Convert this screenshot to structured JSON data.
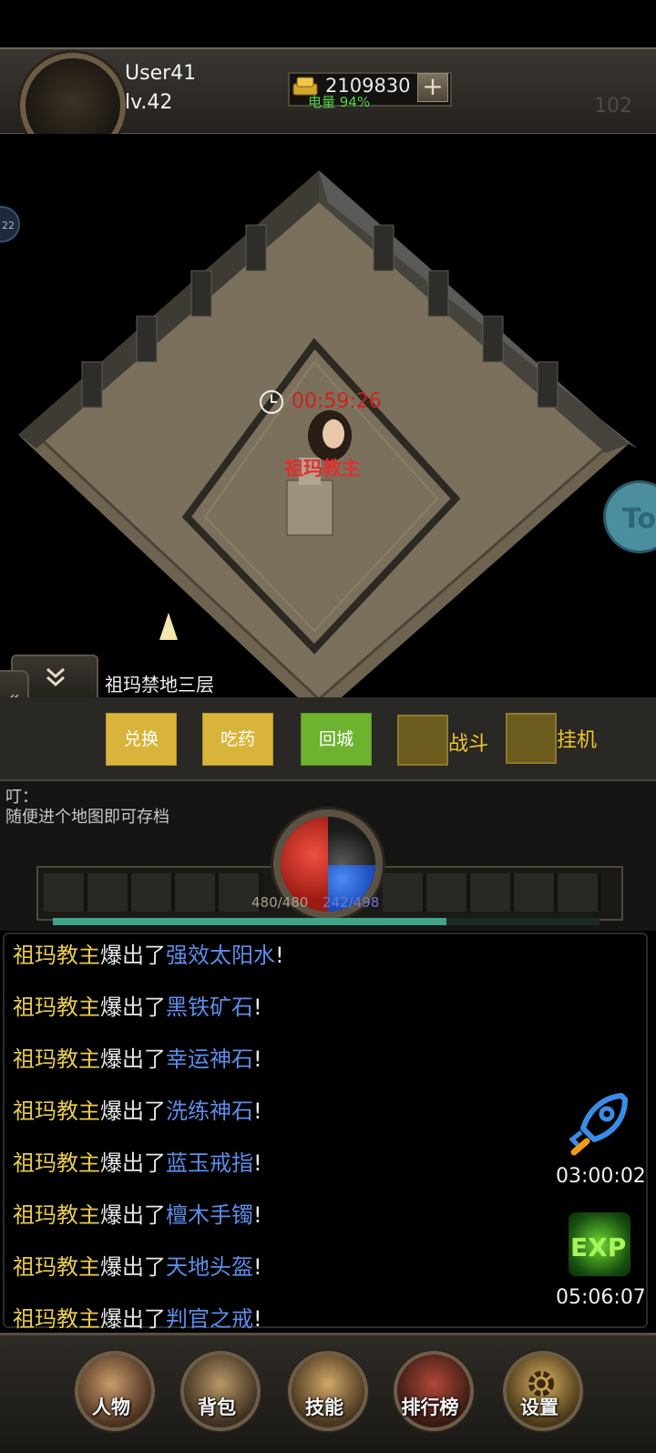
{
  "player": {
    "name": "User41",
    "level": "lv.42"
  },
  "currency": {
    "gold": "2109830",
    "plus": "+"
  },
  "status": {
    "battery": "电量 94%",
    "ping": "102"
  },
  "map": {
    "timer": "00:59:26",
    "boss_name": "祖玛教主",
    "map_name": "祖玛禁地三层",
    "side_bubble": "22",
    "to_bubble": "To"
  },
  "actions": {
    "exchange": "兑换",
    "potion": "吃药",
    "return_city": "回城",
    "battle": "战斗",
    "afk": "挂机"
  },
  "console": {
    "head": "叮：",
    "message": "随便进个地图即可存档"
  },
  "vitals": {
    "hp": "480/480",
    "mp": "242/498",
    "hp_fraction": 1.0,
    "mp_fraction": 0.486,
    "exp_fraction": 0.72
  },
  "loot_log": [
    {
      "boss": "祖玛教主",
      "verb": "爆出了",
      "item": "强效太阳水",
      "end": "!"
    },
    {
      "boss": "祖玛教主",
      "verb": "爆出了",
      "item": "黑铁矿石",
      "end": "!"
    },
    {
      "boss": "祖玛教主",
      "verb": "爆出了",
      "item": "幸运神石",
      "end": "!"
    },
    {
      "boss": "祖玛教主",
      "verb": "爆出了",
      "item": "洗练神石",
      "end": "!"
    },
    {
      "boss": "祖玛教主",
      "verb": "爆出了",
      "item": "蓝玉戒指",
      "end": "!"
    },
    {
      "boss": "祖玛教主",
      "verb": "爆出了",
      "item": "檀木手镯",
      "end": "!"
    },
    {
      "boss": "祖玛教主",
      "verb": "爆出了",
      "item": "天地头盔",
      "end": "!"
    },
    {
      "boss": "祖玛教主",
      "verb": "爆出了",
      "item": "判官之戒",
      "end": "!"
    }
  ],
  "boosts": {
    "rocket_icon": "rocket-icon",
    "rocket_time": "03:00:02",
    "exp_label": "EXP",
    "exp_time": "05:06:07"
  },
  "nav": {
    "character": "人物",
    "bag": "背包",
    "skills": "技能",
    "ranking": "排行榜",
    "settings": "设置"
  },
  "colors": {
    "gold_text": "#e9cc4c",
    "item_text": "#5c8de8",
    "boss_red": "#e03030",
    "button_yellow": "#d8b53a",
    "button_green": "#6db330"
  }
}
